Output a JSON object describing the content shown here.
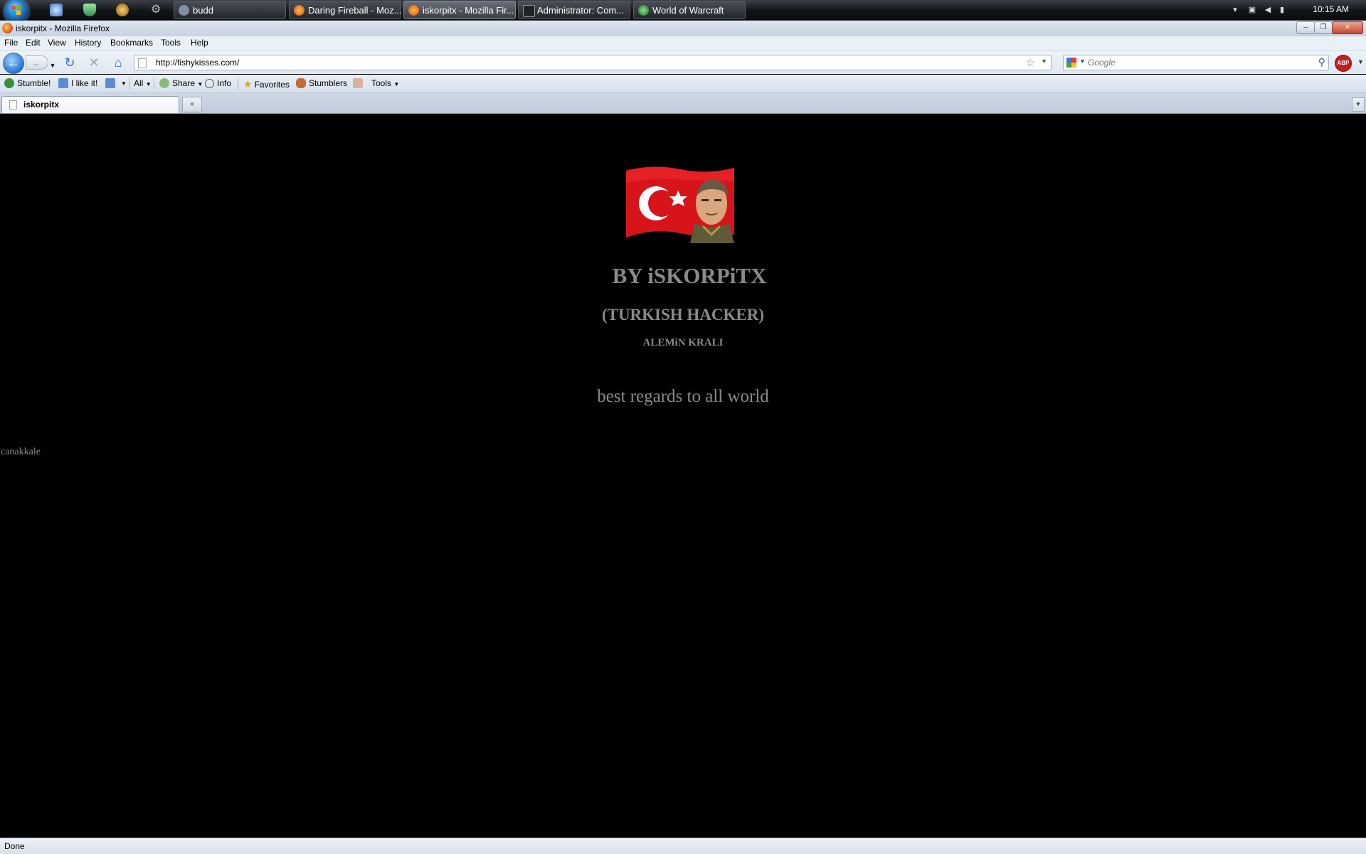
{
  "taskbar": {
    "tasks": [
      {
        "label": "budd"
      },
      {
        "label": "Daring Fireball - Moz..."
      },
      {
        "label": "iskorpitx - Mozilla Fir..."
      },
      {
        "label": "Administrator: Com..."
      },
      {
        "label": "World of Warcraft"
      }
    ],
    "clock": "10:15 AM"
  },
  "window": {
    "title": "iskorpitx - Mozilla Firefox"
  },
  "menubar": {
    "items": [
      "File",
      "Edit",
      "View",
      "History",
      "Bookmarks",
      "Tools",
      "Help"
    ]
  },
  "navbar": {
    "url": "http://fishykisses.com/",
    "search_placeholder": "Google"
  },
  "stumbleupon": {
    "stumble": "Stumble!",
    "like": "I like it!",
    "all": "All",
    "share": "Share",
    "info": "Info",
    "favorites": "Favorites",
    "stumblers": "Stumblers",
    "tools": "Tools"
  },
  "tabs": [
    {
      "label": "iskorpitx"
    }
  ],
  "page": {
    "title": "BY iSKORPiTX",
    "subtitle": "(TURKISH HACKER)",
    "line": "ALEMiN KRALI",
    "regards": "best regards to all world",
    "city": "canakkale"
  },
  "status": {
    "text": "Done"
  },
  "colors": {
    "page_background": "#000000",
    "page_text": "#8a8a8a",
    "flag_red": "#d8141b"
  }
}
